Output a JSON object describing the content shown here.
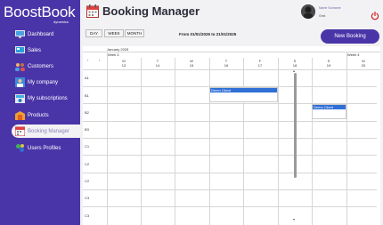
{
  "app": {
    "logo_main": "BoostBook",
    "logo_sub": "dynamics",
    "page_title": "Booking Manager"
  },
  "user": {
    "name": "Name Surname",
    "role": "Gest"
  },
  "sidebar": {
    "items": [
      {
        "label": "Dashboard",
        "icon": "dashboard-icon"
      },
      {
        "label": "Sales",
        "icon": "sales-icon"
      },
      {
        "label": "Customers",
        "icon": "customers-icon"
      },
      {
        "label": "My company",
        "icon": "company-icon"
      },
      {
        "label": "My subscriptions",
        "icon": "subscriptions-icon"
      },
      {
        "label": "Products",
        "icon": "products-icon"
      },
      {
        "label": "Booking Manager",
        "icon": "calendar-icon",
        "active": true
      },
      {
        "label": "Users Profiles",
        "icon": "users-icon"
      }
    ]
  },
  "toolbar": {
    "views": [
      "DAY",
      "WEEK",
      "MONTH"
    ],
    "date_range": "From 01/01/2025 to 21/01/2025",
    "new_booking": "New Booking"
  },
  "calendar": {
    "month": "January 2025",
    "weeks": [
      "Week 3",
      "Week 4"
    ],
    "days": [
      {
        "dow": "M",
        "date": "13"
      },
      {
        "dow": "T",
        "date": "14"
      },
      {
        "dow": "W",
        "date": "15"
      },
      {
        "dow": "T",
        "date": "16"
      },
      {
        "dow": "F",
        "date": "17"
      },
      {
        "dow": "S",
        "date": "18"
      },
      {
        "dow": "S",
        "date": "19"
      },
      {
        "dow": "M",
        "date": "20"
      }
    ],
    "rows": [
      "A1",
      "B1",
      "B2",
      "B3",
      "C1",
      "C2",
      "C2",
      "C3",
      "C3"
    ],
    "bookings": [
      {
        "label": "Demo Client",
        "row": "B1",
        "day": "16"
      },
      {
        "label": "Demo Client",
        "row": "B2",
        "day": "19"
      }
    ]
  },
  "colors": {
    "sidebar": "#4a35a8",
    "accent": "#4a35a8",
    "booking": "#2f6fd6"
  }
}
